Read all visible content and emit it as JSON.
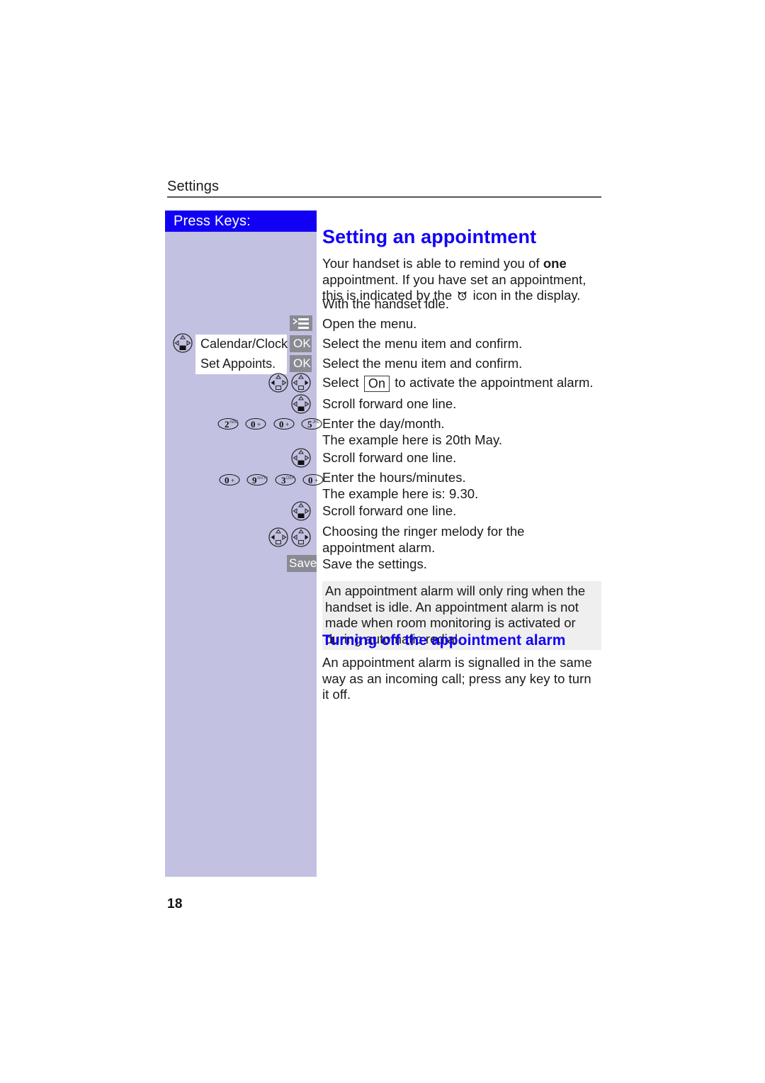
{
  "page": {
    "running_head": "Settings",
    "page_number": "18"
  },
  "keycolumn": {
    "header_label": "Press Keys:",
    "menu_key_icon": "menu-key-icon",
    "display_boxes": [
      {
        "label": "Calendar/Clock"
      },
      {
        "label": "Set Appoints."
      }
    ],
    "ok_label": "OK",
    "save_label": "Save",
    "number_keys_row1": [
      {
        "digit": "2",
        "letters": "ABC"
      },
      {
        "digit": "0",
        "letters": "+"
      },
      {
        "digit": "0",
        "letters": "+"
      },
      {
        "digit": "5",
        "letters": "JKL"
      }
    ],
    "number_keys_row2": [
      {
        "digit": "0",
        "letters": "+"
      },
      {
        "digit": "9",
        "letters": "WXYZ"
      },
      {
        "digit": "3",
        "letters": "DEF"
      },
      {
        "digit": "0",
        "letters": "+"
      }
    ]
  },
  "content": {
    "title": "Setting an appointment",
    "intro_part1": "Your handset is able to remind you of ",
    "intro_bold": "one",
    "intro_part2": " appointment. If you have set an appointment, this is indicated by the ",
    "intro_part3": " icon in the display.",
    "steps": [
      {
        "text": "With the handset idle."
      },
      {
        "text": "Open the menu."
      },
      {
        "text": "Select the menu item and confirm."
      },
      {
        "text": "Select the menu item and confirm."
      },
      {
        "prefix": "Select ",
        "inline_key": "On",
        "suffix": " to activate the appointment alarm."
      },
      {
        "text": "Scroll forward one line."
      },
      {
        "text": "Enter the day/month.",
        "text2": "The example here is 20th May."
      },
      {
        "text": "Scroll forward one line."
      },
      {
        "text": "Enter the hours/minutes.",
        "text2": "The example here is: 9.30."
      },
      {
        "text": "Scroll forward one line."
      },
      {
        "text": "Choosing the ringer melody for the appointment alarm."
      },
      {
        "text": "Save the settings."
      }
    ],
    "note": "An appointment alarm will only ring when the handset is idle. An appointment alarm is not made when room monitoring is activated or during automatic redial.",
    "subtitle": "Turning off the appointment alarm",
    "closing": "An appointment alarm is signalled in the same way as an incoming call; press any key to turn it off."
  },
  "colors": {
    "brand_blue": "#1200f5",
    "sidebar_lavender": "#c2c1e2",
    "softkey_gray": "#8a8a93",
    "note_gray": "#efeff0"
  }
}
